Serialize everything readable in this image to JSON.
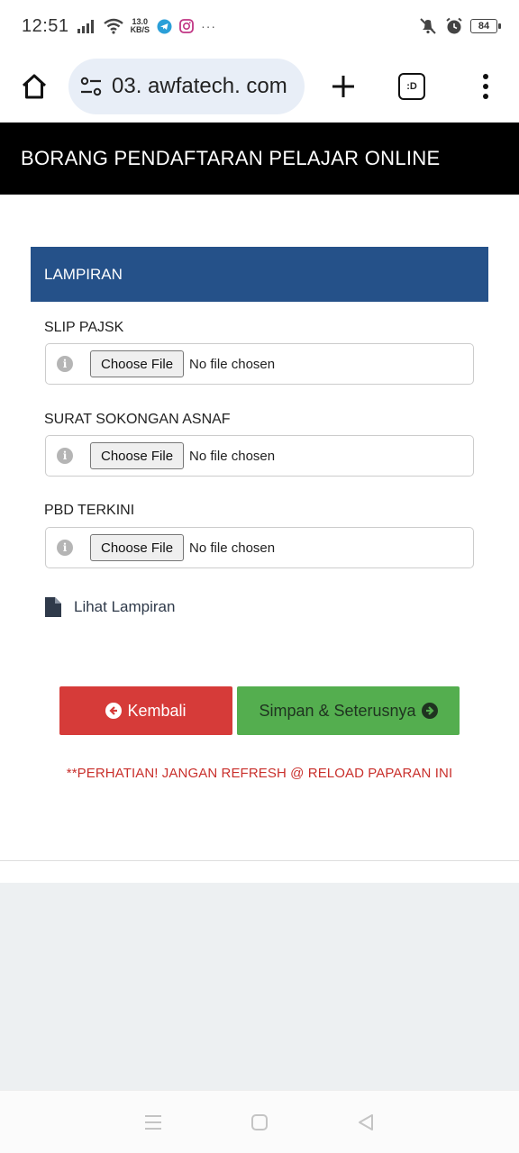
{
  "status_bar": {
    "time": "12:51",
    "net_speed_value": "13.0",
    "net_speed_unit": "KB/S",
    "battery": "84",
    "more": "···"
  },
  "browser": {
    "url": "03. awfatech. com",
    "tabs_label": ":D"
  },
  "page": {
    "header_title": "BORANG PENDAFTARAN PELAJAR ONLINE",
    "panel_title": "LAMPIRAN",
    "fields": [
      {
        "label": "SLIP PAJSK",
        "button": "Choose File",
        "status": "No file chosen"
      },
      {
        "label": "SURAT SOKONGAN ASNAF",
        "button": "Choose File",
        "status": "No file chosen"
      },
      {
        "label": "PBD TERKINI",
        "button": "Choose File",
        "status": "No file chosen"
      }
    ],
    "view_attachment": "Lihat Lampiran",
    "back_button": "Kembali",
    "next_button": "Simpan & Seterusnya",
    "warning": "**PERHATIAN!  JANGAN REFRESH @ RELOAD PAPARAN INI"
  },
  "colors": {
    "header_bg": "#000000",
    "panel_bg": "#255189",
    "back_bg": "#d63b39",
    "next_bg": "#54ae4f",
    "warning": "#c9302c"
  }
}
